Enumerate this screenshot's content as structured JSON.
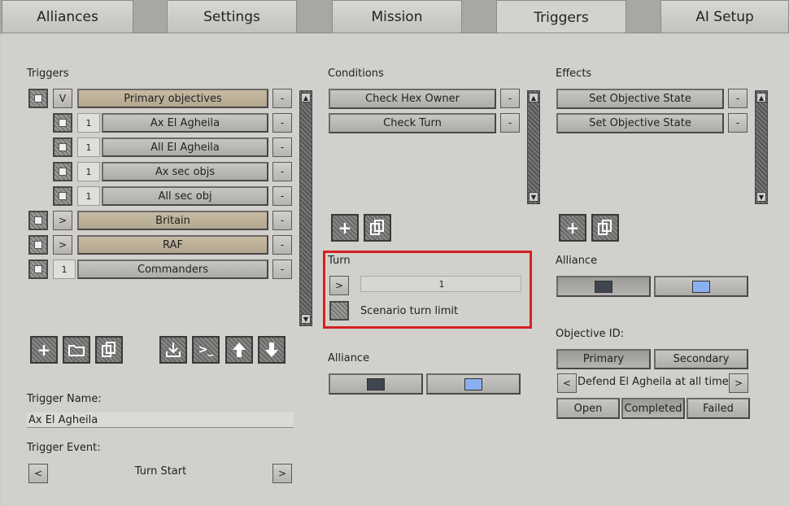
{
  "tabs": [
    "Alliances",
    "Settings",
    "Mission",
    "Triggers",
    "AI Setup"
  ],
  "active_tab": "Triggers",
  "triggers": {
    "label": "Triggers",
    "items": [
      {
        "toggle": "V",
        "name": "Primary objectives",
        "style": "tan",
        "indent": 0
      },
      {
        "toggle": "1",
        "name": "Ax El Agheila",
        "style": "gray",
        "indent": 1
      },
      {
        "toggle": "1",
        "name": "All El Agheila",
        "style": "gray",
        "indent": 1
      },
      {
        "toggle": "1",
        "name": "Ax sec objs",
        "style": "gray",
        "indent": 1
      },
      {
        "toggle": "1",
        "name": "All sec obj",
        "style": "gray",
        "indent": 1
      },
      {
        "toggle": ">",
        "name": "Britain",
        "style": "tan",
        "indent": 0
      },
      {
        "toggle": ">",
        "name": "RAF",
        "style": "tan",
        "indent": 0
      },
      {
        "toggle": "1",
        "name": "Commanders",
        "style": "gray",
        "indent": 0
      }
    ],
    "remove_label": "-"
  },
  "trigger_name": {
    "label": "Trigger Name:",
    "value": "Ax El Agheila"
  },
  "trigger_event": {
    "label": "Trigger Event:",
    "value": "Turn Start",
    "prev": "<",
    "next": ">"
  },
  "conditions": {
    "label": "Conditions",
    "items": [
      "Check Hex Owner",
      "Check Turn"
    ],
    "remove_label": "-"
  },
  "turn_box": {
    "label": "Turn",
    "toggle": ">",
    "value": "1",
    "checkbox_label": "Scenario turn limit"
  },
  "cond_alliance": {
    "label": "Alliance",
    "colors": [
      "#3f4650",
      "#8ab0f0"
    ]
  },
  "effects": {
    "label": "Effects",
    "items": [
      "Set Objective State",
      "Set Objective State"
    ],
    "remove_label": "-"
  },
  "eff_alliance": {
    "label": "Alliance",
    "colors": [
      "#3f4650",
      "#8ab0f0"
    ]
  },
  "objective": {
    "label": "Objective ID:",
    "types": [
      "Primary",
      "Secondary"
    ],
    "selected_type": "Primary",
    "name": "Defend El Agheila at all times",
    "prev": "<",
    "next": ">",
    "states": [
      "Open",
      "Completed",
      "Failed"
    ],
    "selected_state": "Completed"
  },
  "icons": [
    "add-icon",
    "folder-icon",
    "copy-icon",
    "import-icon",
    "console-icon",
    "move-up-icon",
    "move-down-icon"
  ]
}
